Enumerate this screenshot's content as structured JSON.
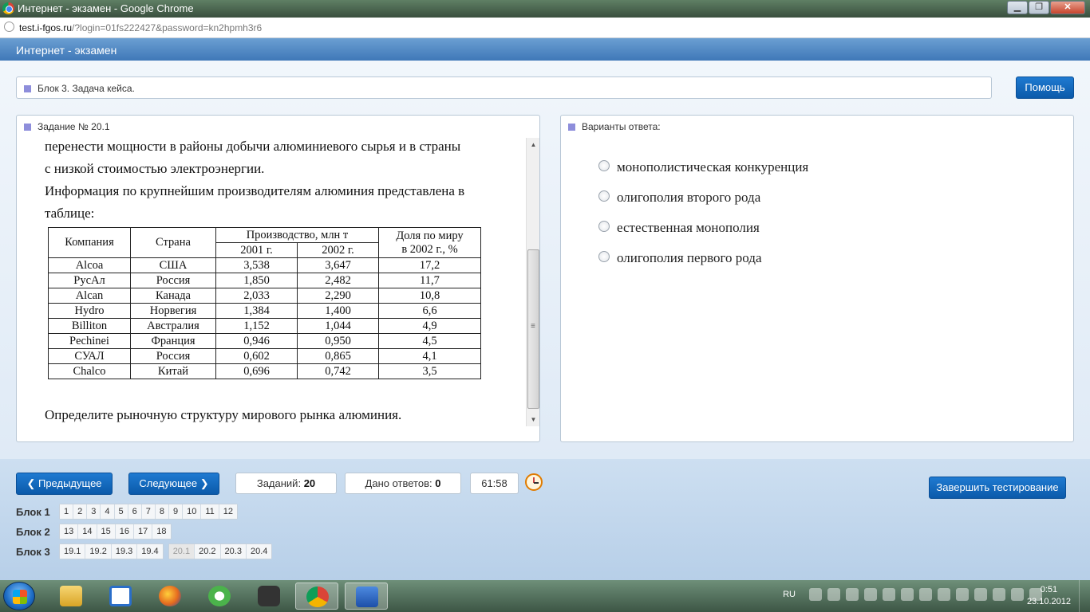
{
  "browser": {
    "window_title": "Интернет - экзамен - Google Chrome",
    "url_host": "test.i-fgos.ru",
    "url_path": "/?login=01fs222427&password=kn2hpmh3r6",
    "win_minimize": "▁",
    "win_maximize": "❐",
    "win_close": "✕"
  },
  "app": {
    "title": "Интернет - экзамен",
    "block_label": "Блок 3. Задача кейса.",
    "help_button": "Помощь"
  },
  "question": {
    "number_label": "Задание № 20.1",
    "paragraphs": [
      "перенести мощности в районы добычи алюминиевого сырья и в страны",
      "с низкой стоимостью электроэнергии.",
      "Информация по крупнейшим производителям алюминия представлена в",
      "таблице:"
    ],
    "table": {
      "headers": {
        "company": "Компания",
        "country": "Страна",
        "production": "Производство, млн т",
        "year_2001": "2001 г.",
        "year_2002": "2002 г.",
        "share_line1": "Доля по миру",
        "share_line2": "в  2002 г., %"
      },
      "rows": [
        [
          "Alcoa",
          "США",
          "3,538",
          "3,647",
          "17,2"
        ],
        [
          "РусАл",
          "Россия",
          "1,850",
          "2,482",
          "11,7"
        ],
        [
          "Alcan",
          "Канада",
          "2,033",
          "2,290",
          "10,8"
        ],
        [
          "Hydro",
          "Норвегия",
          "1,384",
          "1,400",
          "6,6"
        ],
        [
          "Billiton",
          "Австралия",
          "1,152",
          "1,044",
          "4,9"
        ],
        [
          "Pechinei",
          "Франция",
          "0,946",
          "0,950",
          "4,5"
        ],
        [
          "СУАЛ",
          "Россия",
          "0,602",
          "0,865",
          "4,1"
        ],
        [
          "Chalco",
          "Китай",
          "0,696",
          "0,742",
          "3,5"
        ]
      ]
    },
    "prompt": "Определите рыночную структуру мирового рынка алюминия."
  },
  "answers": {
    "label": "Варианты ответа:",
    "options": [
      "монополистическая конкуренция",
      "олигополия второго рода",
      "естественная монополия",
      "олигополия первого рода"
    ]
  },
  "nav": {
    "prev": "Предыдущее",
    "next": "Следующее",
    "tasks_label": "Заданий:",
    "tasks_count": "20",
    "answered_label": "Дано ответов:",
    "answered_count": "0",
    "timer": "61:58",
    "finish": "Завершить тестирование"
  },
  "blocks": [
    {
      "label": "Блок 1",
      "groups": [
        [
          "1",
          "2",
          "3",
          "4",
          "5",
          "6",
          "7",
          "8",
          "9",
          "10",
          "11",
          "12"
        ]
      ]
    },
    {
      "label": "Блок 2",
      "groups": [
        [
          "13",
          "14",
          "15",
          "16",
          "17",
          "18"
        ]
      ]
    },
    {
      "label": "Блок 3",
      "groups": [
        [
          "19.1",
          "19.2",
          "19.3",
          "19.4"
        ],
        [
          "20.1",
          "20.2",
          "20.3",
          "20.4"
        ]
      ]
    }
  ],
  "current_task": "20.1",
  "taskbar": {
    "lang": "RU",
    "time": "0:51",
    "date": "23.10.2012"
  }
}
